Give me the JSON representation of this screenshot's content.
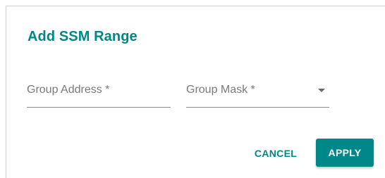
{
  "dialog": {
    "title": "Add SSM Range"
  },
  "form": {
    "group_address": {
      "label": "Group Address *",
      "value": ""
    },
    "group_mask": {
      "label": "Group Mask *",
      "value": ""
    }
  },
  "actions": {
    "cancel_label": "CANCEL",
    "apply_label": "APPLY"
  },
  "colors": {
    "accent": "#008787"
  }
}
